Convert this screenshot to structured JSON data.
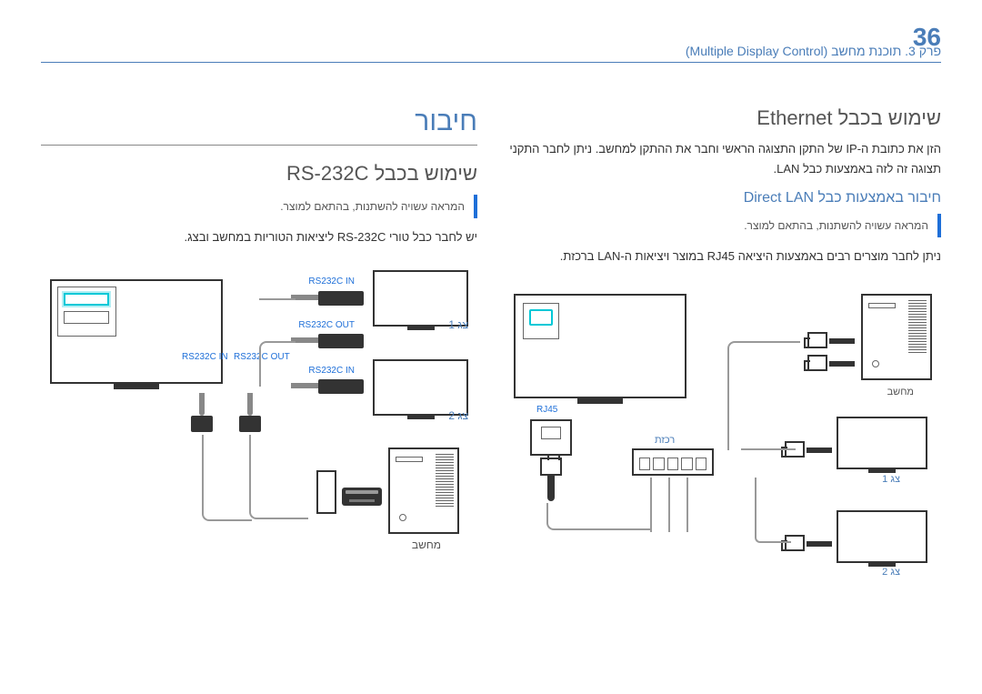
{
  "page_number": "36",
  "breadcrumb": "פרק 3. תוכנת מחשב (Multiple Display Control)",
  "right_col": {
    "h1": "חיבור",
    "h2": "שימוש בכבל RS-232C",
    "note": "המראה עשויה להשתנות, בהתאם למוצר.",
    "body": "יש לחבר כבל טורי RS-232C ליציאות הטוריות במחשב ובצג.",
    "labels": {
      "rs232_in_1": "RS232C IN",
      "rs232_out": "RS232C OUT",
      "rs232_in_2": "RS232C IN",
      "rs232_in_3": "RS232C IN",
      "rs232_out_2": "RS232C OUT",
      "monitor1": "צג 1",
      "monitor2": "צג 2",
      "computer": "מחשב"
    }
  },
  "left_col": {
    "h2": "שימוש בכבל Ethernet",
    "body": "הזן את כתובת ה-IP של התקן התצוגה הראשי וחבר את ההתקן למחשב. ניתן לחבר התקני תצוגה זה לזה באמצעות כבל LAN.",
    "h3": "חיבור באמצעות כבל Direct LAN",
    "note": "המראה עשויה להשתנות, בהתאם למוצר.",
    "body2": "ניתן לחבר מוצרים רבים באמצעות היציאה RJ45 במוצר ויציאות ה-LAN ברכזת.",
    "labels": {
      "rj45": "RJ45",
      "hub": "רכזת",
      "computer": "מחשב",
      "monitor1": "צג 1",
      "monitor2": "צג 2"
    }
  }
}
